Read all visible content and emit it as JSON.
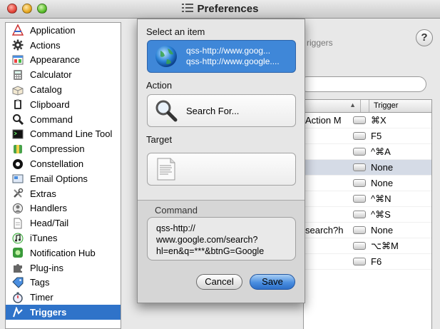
{
  "window": {
    "title": "Preferences"
  },
  "sidebar": {
    "items": [
      {
        "label": "Application",
        "icon": "application-icon"
      },
      {
        "label": "Actions",
        "icon": "gear-icon"
      },
      {
        "label": "Appearance",
        "icon": "appearance-icon"
      },
      {
        "label": "Calculator",
        "icon": "calculator-icon"
      },
      {
        "label": "Catalog",
        "icon": "catalog-icon"
      },
      {
        "label": "Clipboard",
        "icon": "clipboard-icon"
      },
      {
        "label": "Command",
        "icon": "magnifier-icon"
      },
      {
        "label": "Command Line Tool",
        "icon": "terminal-icon"
      },
      {
        "label": "Compression",
        "icon": "compression-icon"
      },
      {
        "label": "Constellation",
        "icon": "constellation-icon"
      },
      {
        "label": "Email Options",
        "icon": "email-icon"
      },
      {
        "label": "Extras",
        "icon": "tools-icon"
      },
      {
        "label": "Handlers",
        "icon": "handlers-icon"
      },
      {
        "label": "Head/Tail",
        "icon": "document-icon"
      },
      {
        "label": "iTunes",
        "icon": "music-note-icon"
      },
      {
        "label": "Notification Hub",
        "icon": "notification-icon"
      },
      {
        "label": "Plug-ins",
        "icon": "puzzle-icon"
      },
      {
        "label": "Tags",
        "icon": "tag-icon"
      },
      {
        "label": "Timer",
        "icon": "stopwatch-icon"
      },
      {
        "label": "Triggers",
        "icon": "trigger-icon",
        "selected": true
      }
    ]
  },
  "background": {
    "tab_fragment": "riggers",
    "table": {
      "trigger_header": "Trigger",
      "rows": [
        {
          "command": "Action M",
          "trigger": "⌘X",
          "highlighted": false
        },
        {
          "command": "",
          "trigger": "F5",
          "highlighted": false
        },
        {
          "command": "",
          "trigger": "^⌘A",
          "highlighted": false
        },
        {
          "command": "",
          "trigger": "None",
          "highlighted": true
        },
        {
          "command": "",
          "trigger": "None",
          "highlighted": false
        },
        {
          "command": "",
          "trigger": "^⌘N",
          "highlighted": false
        },
        {
          "command": "",
          "trigger": "^⌘S",
          "highlighted": false
        },
        {
          "command": "search?h",
          "trigger": "None",
          "highlighted": false
        },
        {
          "command": "",
          "trigger": "⌥⌘M",
          "highlighted": false
        },
        {
          "command": "",
          "trigger": "F6",
          "highlighted": false
        }
      ]
    }
  },
  "sheet": {
    "select_label": "Select an item",
    "item": {
      "line1": "qss-http://www.goog...",
      "line2": "qss-http://www.google...."
    },
    "action_label": "Action",
    "action_value": "Search For...",
    "target_label": "Target",
    "command_label": "Command",
    "command_text": "qss-http://\nwww.google.com/search?\nhl=en&q=***&btnG=Google",
    "cancel_label": "Cancel",
    "save_label": "Save"
  },
  "colors": {
    "selection": "#2f73c9",
    "save_button": "#4a8ee0",
    "row_highlight": "#d5dbe6"
  }
}
